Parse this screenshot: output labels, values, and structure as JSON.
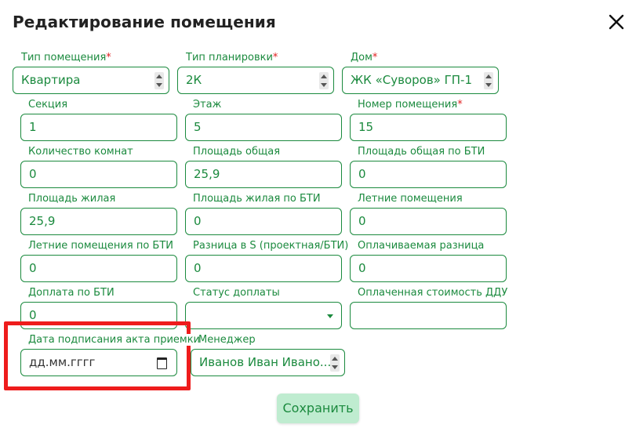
{
  "dialog": {
    "title": "Редактирование помещения",
    "save_label": "Сохранить"
  },
  "fields": {
    "room_type": {
      "label": "Тип помещения",
      "required": "*",
      "value": "Квартира"
    },
    "layout_type": {
      "label": "Тип планировки",
      "required": "*",
      "value": "2К"
    },
    "house": {
      "label": "Дом",
      "required": "*",
      "value": "ЖК «Суворов» ГП-1"
    },
    "section": {
      "label": "Секция",
      "value": "1"
    },
    "floor": {
      "label": "Этаж",
      "value": "5"
    },
    "room_number": {
      "label": "Номер помещения",
      "required": "*",
      "value": "15"
    },
    "rooms_count": {
      "label": "Количество комнат",
      "value": "0"
    },
    "total_area": {
      "label": "Площадь общая",
      "value": "25,9"
    },
    "total_area_bti": {
      "label": "Площадь общая по БТИ",
      "value": "0"
    },
    "living_area": {
      "label": "Площадь жилая",
      "value": "25,9"
    },
    "living_area_bti": {
      "label": "Площадь жилая по БТИ",
      "value": "0"
    },
    "summer_rooms": {
      "label": "Летние помещения",
      "value": "0"
    },
    "summer_rooms_bti": {
      "label": "Летние помещения по БТИ",
      "value": "0"
    },
    "diff_s": {
      "label": "Разница в S (проектная/БТИ)",
      "value": "0"
    },
    "paid_diff": {
      "label": "Оплачиваемая разница",
      "value": "0"
    },
    "surcharge_bti": {
      "label": "Доплата по БТИ",
      "value": "0"
    },
    "surcharge_status": {
      "label": "Статус доплаты",
      "value": ""
    },
    "paid_ddu_cost": {
      "label": "Оплаченная стоимость ДДУ",
      "value": ""
    },
    "act_date": {
      "label": "Дата подписания акта приемки",
      "placeholder": "дд.мм.гггг"
    },
    "manager": {
      "label": "Менеджер",
      "value": "Иванов Иван Ивано..."
    }
  },
  "colors": {
    "accent": "#1b8a3e",
    "required": "#e02020",
    "highlight": "#ee1c1c",
    "button_bg": "#bfecd0"
  },
  "icons": {
    "close": "close-icon",
    "calendar": "calendar-icon",
    "select_arrows": "updown-arrows-icon",
    "dropdown": "chevron-down-icon"
  }
}
